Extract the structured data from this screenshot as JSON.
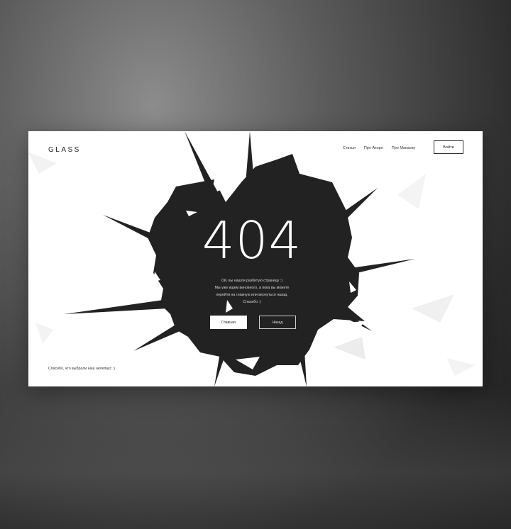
{
  "header": {
    "logo": "GLASS",
    "nav": [
      "Статьи",
      "Про Акоро",
      "Про Макаову"
    ],
    "login_label": "Войти"
  },
  "error": {
    "code": "404",
    "message_lines": [
      "Ой, вы нашли разбитую страницу :)",
      "Мы уже ищем виновного, а пока вы можете",
      "перейти на главную или вернуться назад.",
      "Спасибо :)"
    ],
    "home_label": "Главная",
    "back_label": "Назад"
  },
  "footer": {
    "note": "Спасибо, что выбрали наш нелепаус :)"
  },
  "colors": {
    "hole": "#222222",
    "page_background": "#ffffff",
    "outer_background": "#3a3a3a"
  }
}
